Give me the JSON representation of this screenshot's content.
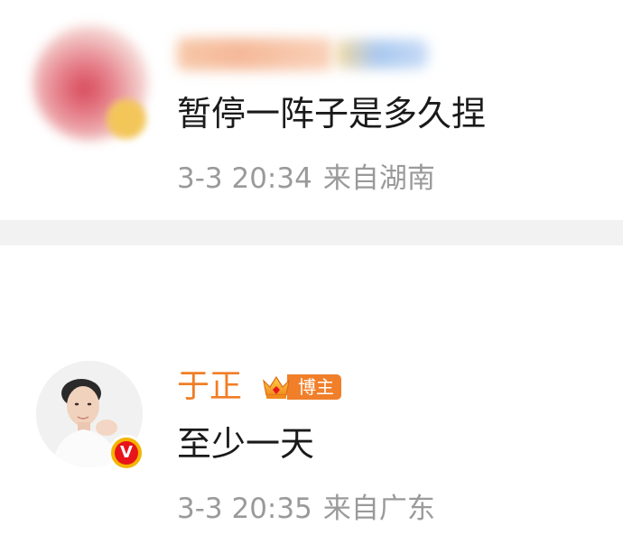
{
  "comments": [
    {
      "username": "",
      "text": "暂停一阵子是多久捏",
      "date": "3-3 20:34",
      "location": "来自湖南"
    },
    {
      "username": "于正",
      "badge": "博主",
      "text": "至少一天",
      "date": "3-3 20:35",
      "location": "来自广东",
      "verified_mark": "V"
    }
  ],
  "colors": {
    "username": "#f07e27",
    "badge_bg": "#f17f2a",
    "meta": "#9a9a9a",
    "text": "#1a1a1a",
    "divider": "#f2f2f2",
    "verified_red": "#e8141a",
    "verified_gold": "#f4b400"
  },
  "icons": [
    "crown-icon",
    "verified-icon"
  ]
}
